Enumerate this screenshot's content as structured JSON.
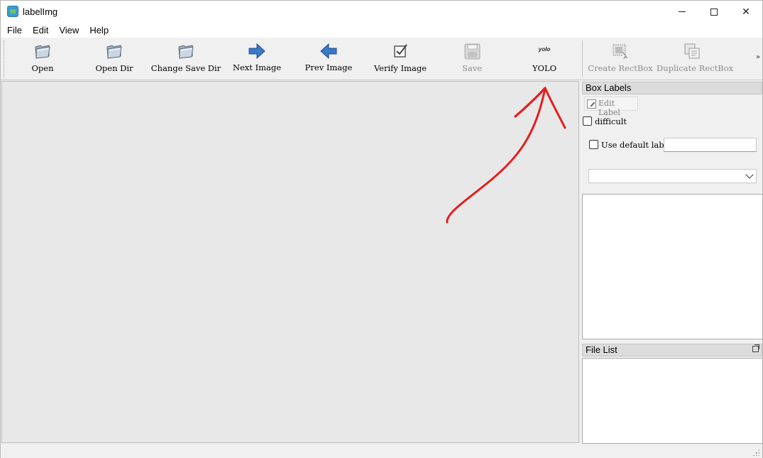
{
  "window": {
    "title": "labelImg",
    "controls": {
      "minimize": "minimize",
      "maximize": "maximize",
      "close": "✕"
    }
  },
  "menu": [
    "File",
    "Edit",
    "View",
    "Help"
  ],
  "toolbar": {
    "tools": [
      {
        "label": "Open",
        "icon": "folder-open-icon",
        "enabled": true
      },
      {
        "label": "Open Dir",
        "icon": "folder-open-icon",
        "enabled": true
      },
      {
        "label": "Change Save Dir",
        "icon": "folder-open-icon",
        "enabled": true
      },
      {
        "label": "Next Image",
        "icon": "arrow-right-icon",
        "enabled": true
      },
      {
        "label": "Prev Image",
        "icon": "arrow-left-icon",
        "enabled": true
      },
      {
        "label": "Verify Image",
        "icon": "checkbox-check-icon",
        "enabled": true
      },
      {
        "label": "Save",
        "icon": "save-icon",
        "enabled": false
      },
      {
        "label": "YOLO",
        "icon": "yolo-icon",
        "icon_text": "yolo",
        "enabled": true
      },
      {
        "label": "Create RectBox",
        "icon": "create-rectbox-icon",
        "enabled": false
      },
      {
        "label": "Duplicate RectBox",
        "icon": "duplicate-rectbox-icon",
        "enabled": false
      }
    ],
    "more": "»"
  },
  "box_labels": {
    "title": "Box Labels",
    "edit_label": "Edit Label",
    "difficult": "difficult",
    "difficult_checked": false,
    "use_default_label": "Use default label",
    "use_default_label_checked": false,
    "default_label_value": "",
    "label_combo_value": "",
    "labels": []
  },
  "file_list": {
    "title": "File List",
    "files": []
  },
  "annotation": {
    "color": "#e41e1e"
  },
  "colors": {
    "canvas": "#e8e8e8",
    "toolbar": "#f0f0f0",
    "arrow_blue": "#3a78c8",
    "disabled_text": "#8c8c8c"
  }
}
